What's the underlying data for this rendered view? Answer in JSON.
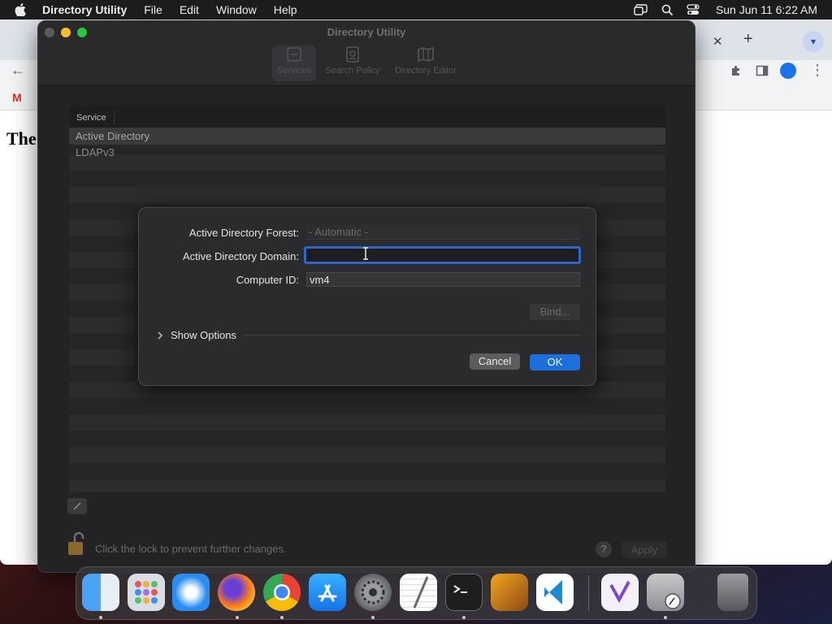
{
  "menubar": {
    "app_name": "Directory Utility",
    "menus": [
      "File",
      "Edit",
      "Window",
      "Help"
    ],
    "clock": "Sun Jun 11  6:22 AM"
  },
  "browser": {
    "page_text": "The",
    "bookmark_initial": "M"
  },
  "window": {
    "title": "Directory Utility",
    "tabs": [
      "Services",
      "Search Policy",
      "Directory Editor"
    ],
    "table": {
      "header": "Service",
      "rows": [
        "Active Directory",
        "LDAPv3"
      ]
    },
    "lock_text": "Click the lock to prevent further changes.",
    "help_label": "?",
    "apply_label": "Apply"
  },
  "dialog": {
    "forest_label": "Active Directory Forest:",
    "forest_placeholder": "- Automatic -",
    "domain_label": "Active Directory Domain:",
    "domain_value": "",
    "computer_id_label": "Computer ID:",
    "computer_id_value": "vm4",
    "bind_label": "Bind...",
    "show_options_label": "Show Options",
    "cancel_label": "Cancel",
    "ok_label": "OK"
  },
  "dock": {
    "apps": [
      "Finder",
      "Launchpad",
      "Safari",
      "Firefox",
      "Chrome",
      "App Store",
      "System Settings",
      "TextEdit",
      "Terminal",
      "GarageBand",
      "Visual Studio Code",
      "Visual Studio",
      "Directory Utility",
      "Trash"
    ]
  },
  "colors": {
    "accent": "#1d6fdc",
    "focus_ring": "#2f66c9",
    "window_bg": "#232325",
    "dialog_bg": "#2b2b2d"
  }
}
